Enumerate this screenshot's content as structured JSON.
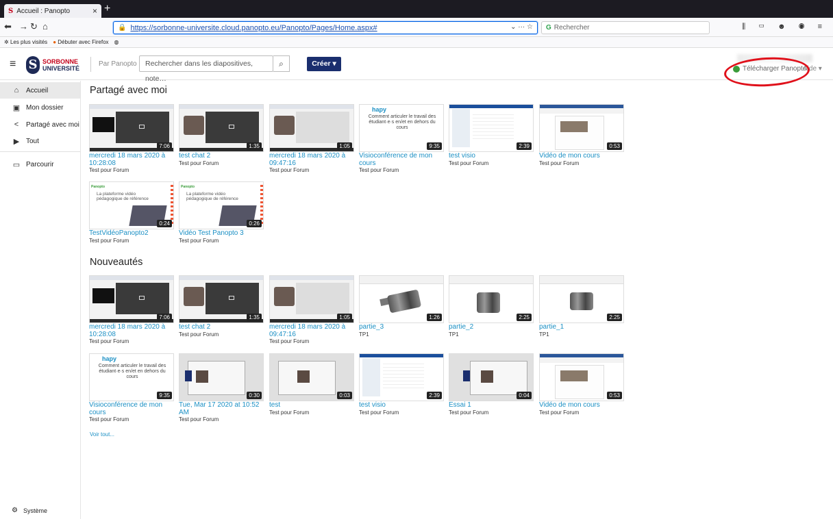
{
  "browser": {
    "tab_title": "Accueil : Panopto",
    "tab_close": "×",
    "new_tab": "+",
    "url": "https://sorbonne-universite.cloud.panopto.eu/Panopto/Pages/Home.aspx#",
    "url_extras": "⌄ ··· ☆",
    "search_placeholder": "Rechercher",
    "bookmark_most_visited": "Les plus visités",
    "bookmark_getting_started": "Débuter avec Firefox"
  },
  "header": {
    "logo_top": "SORBONNE",
    "logo_bottom": "UNIVERSITÉ",
    "par_panopto": "Par Panopto",
    "search_placeholder": "Rechercher dans les diapositives, note…",
    "create_button": "Créer ▾",
    "download_panopto": "Télécharger Panopto",
    "aide": "Aide ▾"
  },
  "sidebar": {
    "items": [
      {
        "label": "Accueil",
        "icon": "home-icon"
      },
      {
        "label": "Mon dossier",
        "icon": "folder-user-icon"
      },
      {
        "label": "Partagé avec moi",
        "icon": "share-icon"
      },
      {
        "label": "Tout",
        "icon": "video-library-icon"
      },
      {
        "label": "Parcourir",
        "icon": "folder-icon"
      }
    ],
    "system": "Système"
  },
  "sections": {
    "shared_title": "Partagé avec moi",
    "new_title": "Nouveautés",
    "view_all": "Voir tout..."
  },
  "shared": [
    {
      "title": "mercredi 18 mars 2020 à 10:28:08",
      "sub": "Test pour Forum",
      "dur": "7:06"
    },
    {
      "title": "test chat 2",
      "sub": "Test pour Forum",
      "dur": "1:35"
    },
    {
      "title": "mercredi 18 mars 2020 à 09:47:16",
      "sub": "Test pour Forum",
      "dur": "1:05"
    },
    {
      "title": "Visioconférence de mon cours",
      "sub": "Test pour Forum",
      "dur": "9:35"
    },
    {
      "title": "test visio",
      "sub": "Test pour Forum",
      "dur": "2:39"
    },
    {
      "title": "Vidéo de mon cours",
      "sub": "Test pour Forum",
      "dur": "0:53"
    },
    {
      "title": "TestVidéoPanopto2",
      "sub": "Test pour Forum",
      "dur": "0:24"
    },
    {
      "title": "Vidéo Test Panopto 3",
      "sub": "Test pour Forum",
      "dur": "0:26"
    }
  ],
  "news": [
    {
      "title": "mercredi 18 mars 2020 à 10:28:08",
      "sub": "Test pour Forum",
      "dur": "7:06"
    },
    {
      "title": "test chat 2",
      "sub": "Test pour Forum",
      "dur": "1:35"
    },
    {
      "title": "mercredi 18 mars 2020 à 09:47:16",
      "sub": "Test pour Forum",
      "dur": "1:05"
    },
    {
      "title": "partie_3",
      "sub": "TP1",
      "dur": "1:26"
    },
    {
      "title": "partie_2",
      "sub": "TP1",
      "dur": "2:25"
    },
    {
      "title": "partie_1",
      "sub": "TP1",
      "dur": "2:25"
    },
    {
      "title": "Visioconférence de mon cours",
      "sub": "Test pour Forum",
      "dur": "9:35"
    },
    {
      "title": "Tue, Mar 17 2020 at 10:52 AM",
      "sub": "Test pour Forum",
      "dur": "0:30"
    },
    {
      "title": "test",
      "sub": "Test pour Forum",
      "dur": "0:03"
    },
    {
      "title": "test visio",
      "sub": "Test pour Forum",
      "dur": "2:39"
    },
    {
      "title": "Essai 1",
      "sub": "Test pour Forum",
      "dur": "0:04"
    },
    {
      "title": "Vidéo de mon cours",
      "sub": "Test pour Forum",
      "dur": "0:53"
    }
  ],
  "hapy_thumb": {
    "logo": "hapy",
    "text": "Comment articuler le travail des étudiant·e·s en/et en dehors du cours"
  },
  "panopto_thumb": {
    "brand": "Panopto",
    "text": "La plateforme vidéo pédagogique de référence"
  }
}
